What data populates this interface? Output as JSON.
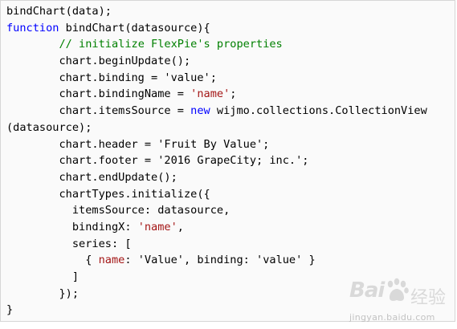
{
  "code": {
    "lines": [
      [
        {
          "t": "bindChart(data);",
          "c": ""
        }
      ],
      [
        {
          "t": "function",
          "c": "kw"
        },
        {
          "t": " bindChart(datasource){",
          "c": ""
        }
      ],
      [
        {
          "t": "        ",
          "c": ""
        },
        {
          "t": "// initialize FlexPie's properties",
          "c": "cm"
        }
      ],
      [
        {
          "t": "        chart.beginUpdate();",
          "c": ""
        }
      ],
      [
        {
          "t": "        chart.binding = 'value';",
          "c": ""
        }
      ],
      [
        {
          "t": "        chart.bindingName = ",
          "c": ""
        },
        {
          "t": "'name'",
          "c": "str"
        },
        {
          "t": ";",
          "c": ""
        }
      ],
      [
        {
          "t": "        chart.itemsSource = ",
          "c": ""
        },
        {
          "t": "new",
          "c": "kw"
        },
        {
          "t": " wijmo.collections.CollectionView",
          "c": ""
        }
      ],
      [
        {
          "t": "(datasource);",
          "c": ""
        }
      ],
      [
        {
          "t": "        chart.header = 'Fruit By Value';",
          "c": ""
        }
      ],
      [
        {
          "t": "        chart.footer = '2016 GrapeCity; inc.';",
          "c": ""
        }
      ],
      [
        {
          "t": "        chart.endUpdate();",
          "c": ""
        }
      ],
      [
        {
          "t": "        chartTypes.initialize({",
          "c": ""
        }
      ],
      [
        {
          "t": "          itemsSource: datasource,",
          "c": ""
        }
      ],
      [
        {
          "t": "          bindingX: ",
          "c": ""
        },
        {
          "t": "'name'",
          "c": "str"
        },
        {
          "t": ",",
          "c": ""
        }
      ],
      [
        {
          "t": "          series: [",
          "c": ""
        }
      ],
      [
        {
          "t": "            { ",
          "c": ""
        },
        {
          "t": "name",
          "c": "str"
        },
        {
          "t": ": 'Value', binding: 'value' }",
          "c": ""
        }
      ],
      [
        {
          "t": "          ]",
          "c": ""
        }
      ],
      [
        {
          "t": "        });",
          "c": ""
        }
      ],
      [
        {
          "t": "}",
          "c": ""
        }
      ]
    ]
  },
  "watermark": {
    "brand": "Bai",
    "brand_suffix": "经验",
    "domain": "jingyan.baidu.com",
    "icon": "baidu-paw-icon"
  },
  "colors": {
    "keyword": "#0000ff",
    "comment": "#008000",
    "string": "#a31515",
    "text": "#000000",
    "background": "#fafafa",
    "border": "#d6d6d6"
  }
}
